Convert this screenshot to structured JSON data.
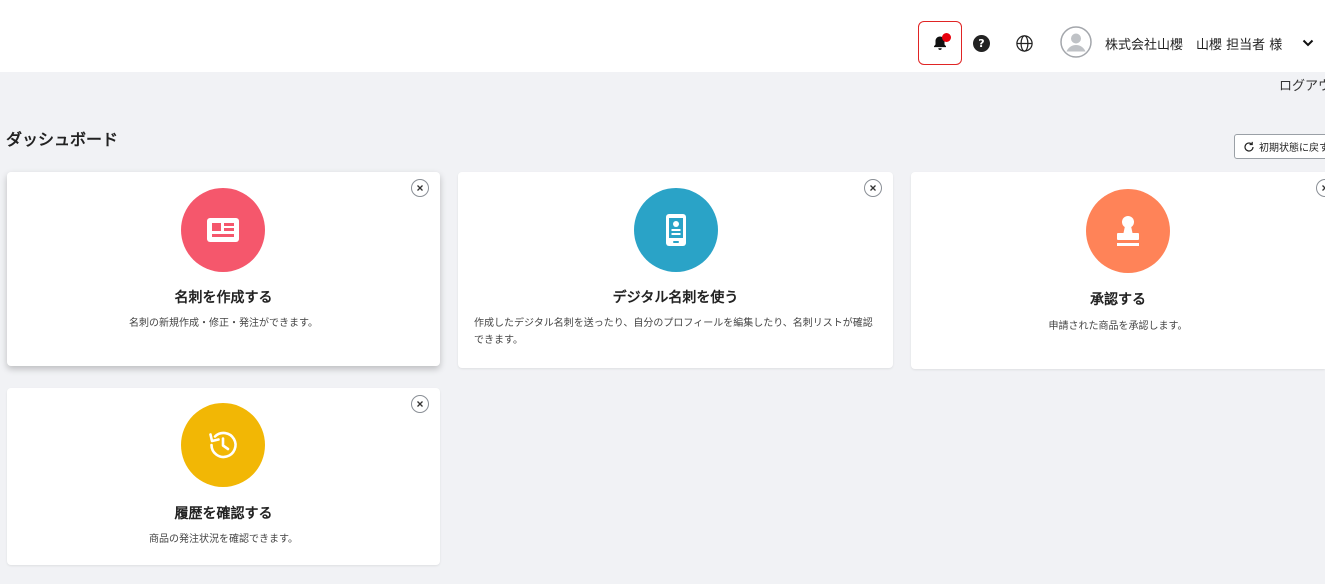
{
  "header": {
    "user_name": "株式会社山櫻　山櫻 担当者 様",
    "help_symbol": "?",
    "logout_label": "ログアウト",
    "notification_badge_color": "#e8000c",
    "icons": [
      "bell-icon",
      "help-icon",
      "globe-icon",
      "avatar-icon",
      "chevron-down-icon"
    ]
  },
  "page": {
    "title": "ダッシュボード",
    "reset_label": "初期状態に戻す"
  },
  "cards": [
    {
      "title": "名刺を作成する",
      "description": "名刺の新規作成・修正・発注ができます。",
      "icon": "business-card-icon",
      "color": "#f5576c"
    },
    {
      "title": "デジタル名刺を使う",
      "description": "作成したデジタル名刺を送ったり、自分のプロフィールを編集したり、名刺リストが確認できます。",
      "icon": "mobile-card-icon",
      "color": "#2aa3c7"
    },
    {
      "title": "承認する",
      "description": "申請された商品を承認します。",
      "icon": "approval-stamp-icon",
      "color": "#ff8358"
    },
    {
      "title": "履歴を確認する",
      "description": "商品の発注状況を確認できます。",
      "icon": "history-icon",
      "color": "#f2b705"
    }
  ]
}
